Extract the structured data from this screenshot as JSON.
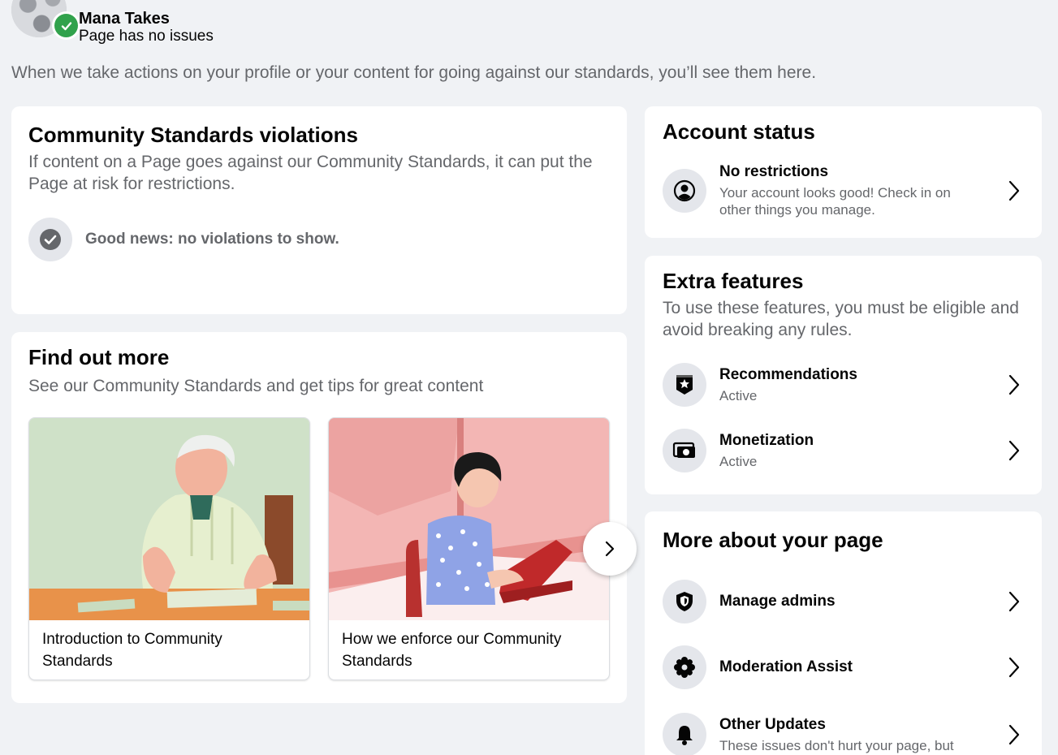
{
  "header": {
    "page_name": "Mana Takes",
    "status": "Page has no issues"
  },
  "intro": "When we take actions on your profile or your content for going against our standards, you’ll see them here.",
  "violations": {
    "title": "Community Standards violations",
    "subtitle": "If content on a Page goes against our Community Standards, it can put the Page at risk for restrictions.",
    "good_news": "Good news: no violations to show."
  },
  "find_out_more": {
    "title": "Find out more",
    "subtitle": "See our Community Standards and get tips for great content",
    "articles": [
      {
        "title": "Introduction to Community Standards"
      },
      {
        "title": "How we enforce our Community Standards"
      }
    ]
  },
  "account_status": {
    "title": "Account status",
    "row": {
      "title": "No restrictions",
      "subtitle": "Your account looks good! Check in on other things you manage."
    }
  },
  "extra_features": {
    "title": "Extra features",
    "subtitle": "To use these features, you must be eligible and avoid breaking any rules.",
    "items": [
      {
        "title": "Recommendations",
        "status": "Active"
      },
      {
        "title": "Monetization",
        "status": "Active"
      }
    ]
  },
  "more_about": {
    "title": "More about your page",
    "items": [
      {
        "title": "Manage admins"
      },
      {
        "title": "Moderation Assist"
      },
      {
        "title": "Other Updates",
        "subtitle": "These issues don't hurt your page, but"
      }
    ]
  },
  "colors": {
    "success_green": "#31a24c",
    "secondary_text": "#65676b",
    "icon_bg": "#e4e6eb",
    "page_bg": "#f0f2f5"
  }
}
